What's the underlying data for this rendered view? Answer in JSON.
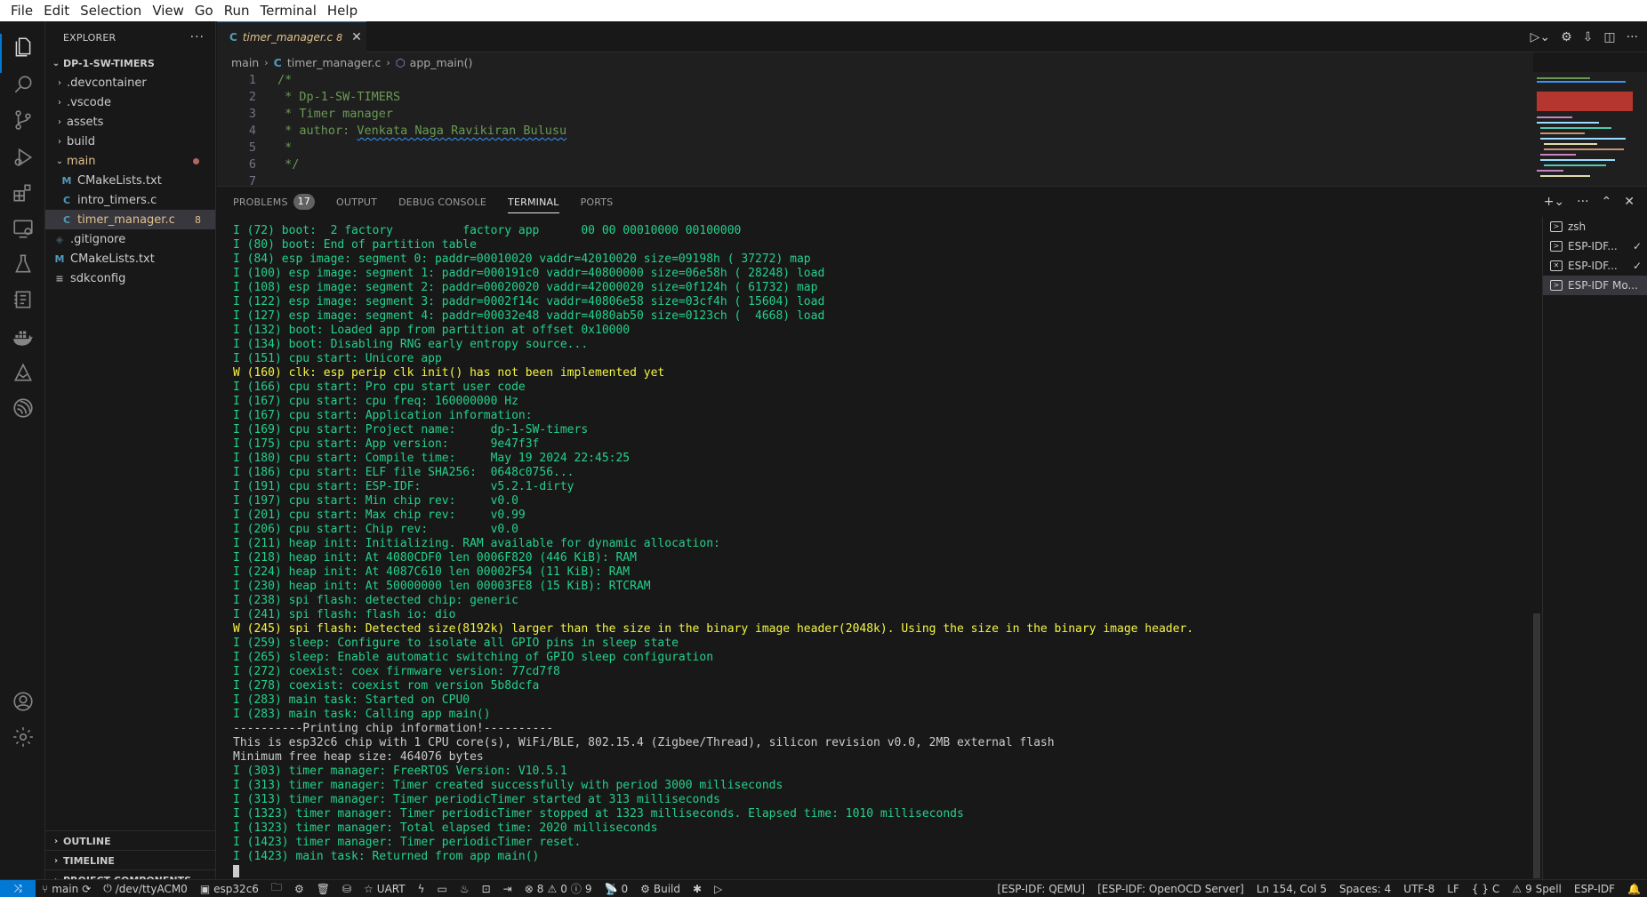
{
  "menu": [
    "File",
    "Edit",
    "Selection",
    "View",
    "Go",
    "Run",
    "Terminal",
    "Help"
  ],
  "explorer": {
    "title": "EXPLORER",
    "project": "DP-1-SW-TIMERS",
    "items": [
      {
        "label": ".devcontainer",
        "kind": "folder"
      },
      {
        "label": ".vscode",
        "kind": "folder"
      },
      {
        "label": "assets",
        "kind": "folder"
      },
      {
        "label": "build",
        "kind": "folder"
      },
      {
        "label": "main",
        "kind": "folder-open"
      },
      {
        "label": "CMakeLists.txt",
        "kind": "cmake"
      },
      {
        "label": "intro_timers.c",
        "kind": "c"
      },
      {
        "label": "timer_manager.c",
        "kind": "c",
        "badge": "8"
      },
      {
        "label": ".gitignore",
        "kind": "git"
      },
      {
        "label": "CMakeLists.txt",
        "kind": "cmake"
      },
      {
        "label": "sdkconfig",
        "kind": "text"
      }
    ],
    "sections": [
      "OUTLINE",
      "TIMELINE",
      "PROJECT COMPONENTS"
    ]
  },
  "tab": {
    "icon": "C",
    "name": "timer_manager.c",
    "count": "8"
  },
  "breadcrumb": {
    "folder": "main",
    "file": "timer_manager.c",
    "symbol": "app_main()"
  },
  "code": [
    {
      "n": "1",
      "text": "/*"
    },
    {
      "n": "2",
      "text": " * Dp-1-SW-TIMERS"
    },
    {
      "n": "3",
      "text": " * Timer manager"
    },
    {
      "n": "4",
      "pre": " * author: ",
      "author": "Venkata Naga Ravikiran Bulusu"
    },
    {
      "n": "5",
      "text": " *"
    },
    {
      "n": "6",
      "text": " */"
    },
    {
      "n": "7",
      "text": ""
    }
  ],
  "panel": {
    "tabs": [
      "PROBLEMS",
      "OUTPUT",
      "DEBUG CONSOLE",
      "TERMINAL",
      "PORTS"
    ],
    "problems_count": "17",
    "active_tab": "TERMINAL"
  },
  "terminals": [
    {
      "label": "zsh",
      "check": ""
    },
    {
      "label": "ESP-IDF...",
      "check": "✓"
    },
    {
      "label": "ESP-IDF...",
      "check": "✓"
    },
    {
      "label": "ESP-IDF Mo...",
      "check": ""
    }
  ],
  "terminal_lines": [
    {
      "t": "I (72) boot:  2 factory          factory app      00 00 00010000 00100000",
      "c": "info"
    },
    {
      "t": "I (80) boot: End of partition table",
      "c": "info"
    },
    {
      "t": "I (84) esp image: segment 0: paddr=00010020 vaddr=42010020 size=09198h ( 37272) map",
      "c": "info"
    },
    {
      "t": "I (100) esp image: segment 1: paddr=000191c0 vaddr=40800000 size=06e58h ( 28248) load",
      "c": "info"
    },
    {
      "t": "I (108) esp image: segment 2: paddr=00020020 vaddr=42000020 size=0f124h ( 61732) map",
      "c": "info"
    },
    {
      "t": "I (122) esp image: segment 3: paddr=0002f14c vaddr=40806e58 size=03cf4h ( 15604) load",
      "c": "info"
    },
    {
      "t": "I (127) esp image: segment 4: paddr=00032e48 vaddr=4080ab50 size=0123ch (  4668) load",
      "c": "info"
    },
    {
      "t": "I (132) boot: Loaded app from partition at offset 0x10000",
      "c": "info"
    },
    {
      "t": "I (134) boot: Disabling RNG early entropy source...",
      "c": "info"
    },
    {
      "t": "I (151) cpu start: Unicore app",
      "c": "info"
    },
    {
      "t": "W (160) clk: esp perip clk init() has not been implemented yet",
      "c": "warn"
    },
    {
      "t": "I (166) cpu start: Pro cpu start user code",
      "c": "info"
    },
    {
      "t": "I (167) cpu start: cpu freq: 160000000 Hz",
      "c": "info"
    },
    {
      "t": "I (167) cpu start: Application information:",
      "c": "info"
    },
    {
      "t": "I (169) cpu start: Project name:     dp-1-SW-timers",
      "c": "info"
    },
    {
      "t": "I (175) cpu start: App version:      9e47f3f",
      "c": "info"
    },
    {
      "t": "I (180) cpu start: Compile time:     May 19 2024 22:45:25",
      "c": "info"
    },
    {
      "t": "I (186) cpu start: ELF file SHA256:  0648c0756...",
      "c": "info"
    },
    {
      "t": "I (191) cpu start: ESP-IDF:          v5.2.1-dirty",
      "c": "info"
    },
    {
      "t": "I (197) cpu start: Min chip rev:     v0.0",
      "c": "info"
    },
    {
      "t": "I (201) cpu start: Max chip rev:     v0.99",
      "c": "info"
    },
    {
      "t": "I (206) cpu start: Chip rev:         v0.0",
      "c": "info"
    },
    {
      "t": "I (211) heap init: Initializing. RAM available for dynamic allocation:",
      "c": "info"
    },
    {
      "t": "I (218) heap init: At 4080CDF0 len 0006F820 (446 KiB): RAM",
      "c": "info"
    },
    {
      "t": "I (224) heap init: At 4087C610 len 00002F54 (11 KiB): RAM",
      "c": "info"
    },
    {
      "t": "I (230) heap init: At 50000000 len 00003FE8 (15 KiB): RTCRAM",
      "c": "info"
    },
    {
      "t": "I (238) spi flash: detected chip: generic",
      "c": "info"
    },
    {
      "t": "I (241) spi flash: flash io: dio",
      "c": "info"
    },
    {
      "t": "W (245) spi flash: Detected size(8192k) larger than the size in the binary image header(2048k). Using the size in the binary image header.",
      "c": "warn"
    },
    {
      "t": "I (259) sleep: Configure to isolate all GPIO pins in sleep state",
      "c": "info"
    },
    {
      "t": "I (265) sleep: Enable automatic switching of GPIO sleep configuration",
      "c": "info"
    },
    {
      "t": "I (272) coexist: coex firmware version: 77cd7f8",
      "c": "info"
    },
    {
      "t": "I (278) coexist: coexist rom version 5b8dcfa",
      "c": "info"
    },
    {
      "t": "I (283) main task: Started on CPU0",
      "c": "info"
    },
    {
      "t": "I (283) main task: Calling app main()",
      "c": "info"
    },
    {
      "t": "----------Printing chip information!----------",
      "c": "plain"
    },
    {
      "t": "This is esp32c6 chip with 1 CPU core(s), WiFi/BLE, 802.15.4 (Zigbee/Thread), silicon revision v0.0, 2MB external flash",
      "c": "plain"
    },
    {
      "t": "Minimum free heap size: 464076 bytes",
      "c": "plain"
    },
    {
      "t": "I (303) timer manager: FreeRTOS Version: V10.5.1",
      "c": "info"
    },
    {
      "t": "I (313) timer manager: Timer created successfully with period 3000 milliseconds",
      "c": "info"
    },
    {
      "t": "I (313) timer manager: Timer periodicTimer started at 313 milliseconds",
      "c": "info"
    },
    {
      "t": "I (1323) timer manager: Timer periodicTimer stopped at 1323 milliseconds. Elapsed time: 1010 milliseconds",
      "c": "info"
    },
    {
      "t": "I (1323) timer manager: Total elapsed time: 2020 milliseconds",
      "c": "info"
    },
    {
      "t": "I (1423) timer manager: Timer periodicTimer reset.",
      "c": "info"
    },
    {
      "t": "I (1423) main task: Returned from app main()",
      "c": "info"
    }
  ],
  "status": {
    "branch": "main",
    "port": "/dev/ttyACM0",
    "target": "esp32c6",
    "flash_type": "UART",
    "errors": "8",
    "warnings": "0",
    "infos": "9",
    "ports": "0",
    "build": "Build",
    "qemu": "[ESP-IDF: QEMU]",
    "openocd": "[ESP-IDF: OpenOCD Server]",
    "position": "Ln 154, Col 5",
    "spaces": "Spaces: 4",
    "encoding": "UTF-8",
    "eol": "LF",
    "language": "C",
    "spell": "9 Spell",
    "idf": "ESP-IDF"
  },
  "colors": {
    "accent": "#0078d4",
    "info": "#23d18b",
    "warn": "#f5f543",
    "modified": "#e2c08d",
    "c_icon": "#519aba"
  }
}
